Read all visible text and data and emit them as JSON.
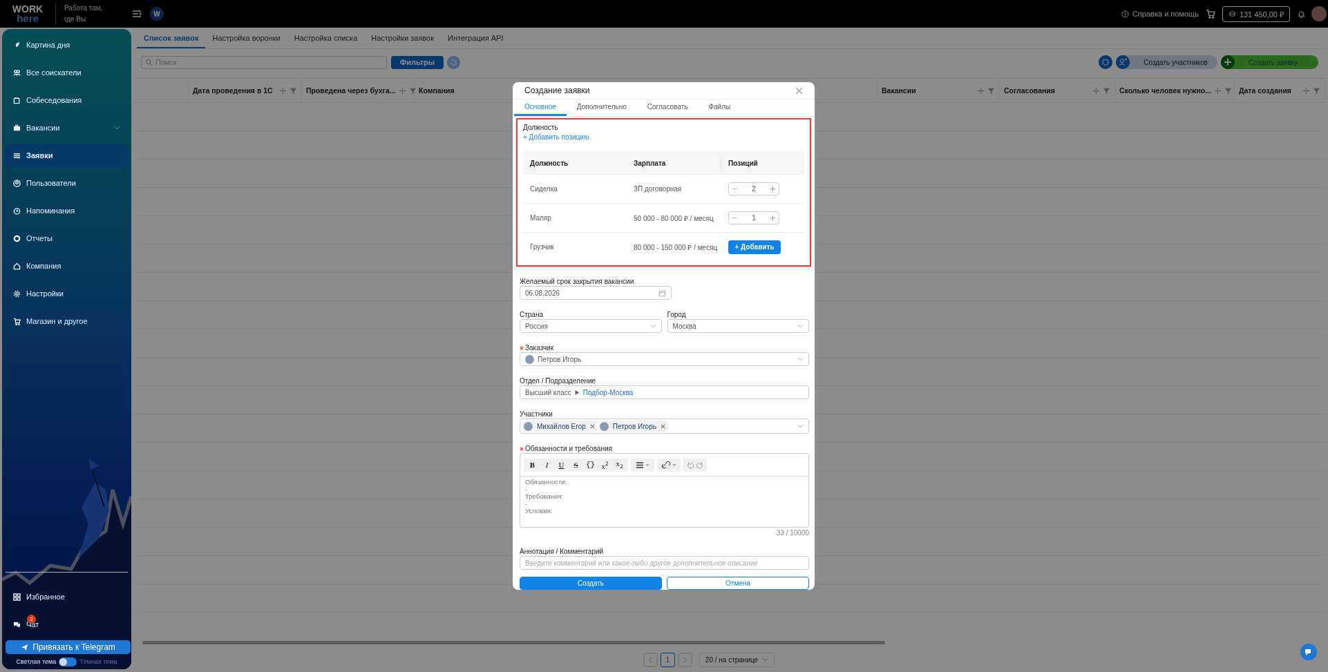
{
  "header": {
    "logo_top": "WORK",
    "logo_bottom": "here",
    "tagline": "Работа там, где Вы",
    "org_badge": "W",
    "help": "Справка и помощь",
    "balance": "131 450,00 ₽"
  },
  "sidebar": {
    "items": [
      {
        "label": "Картина дня",
        "selected": false
      },
      {
        "label": "Все соискатели",
        "selected": false
      },
      {
        "label": "Собеседования",
        "selected": false
      },
      {
        "label": "Вакансии",
        "selected": false,
        "expandable": true
      },
      {
        "label": "Заявки",
        "selected": true
      },
      {
        "label": "Пользователи",
        "selected": false
      },
      {
        "label": "Напоминания",
        "selected": false
      },
      {
        "label": "Отчеты",
        "selected": false
      },
      {
        "label": "Компания",
        "selected": false
      },
      {
        "label": "Настройки",
        "selected": false
      },
      {
        "label": "Магазин и другое",
        "selected": false
      }
    ],
    "bottom_items": [
      {
        "label": "Избранное"
      },
      {
        "label": "Чат",
        "badge": "2"
      }
    ],
    "telegram_button": "Привязать к Telegram",
    "theme": {
      "light_label": "Светлая тема",
      "dark_label": "Тёмная тема",
      "dark": false
    }
  },
  "tabs": [
    {
      "label": "Список заявок",
      "selected": true
    },
    {
      "label": "Настройка воронки",
      "selected": false
    },
    {
      "label": "Настройка списка",
      "selected": false
    },
    {
      "label": "Настройки заявок",
      "selected": false
    },
    {
      "label": "Интеграция API",
      "selected": false
    }
  ],
  "toolbar": {
    "search_placeholder": "Поиск",
    "filter_button": "Фильтры",
    "create_participants": "Создать участников",
    "create_request": "Создать заявку"
  },
  "table": {
    "columns": [
      {
        "kind": "blank"
      },
      {
        "kind": "text",
        "label": "Дата проведения в 1С"
      },
      {
        "kind": "text",
        "label": "Проведена через бухга..."
      },
      {
        "kind": "label_only",
        "label": "Компания"
      },
      {
        "kind": "blank"
      },
      {
        "kind": "text",
        "label": "Вакансии"
      },
      {
        "kind": "text",
        "label": "Согласования"
      },
      {
        "kind": "text",
        "label": "Сколько человек нужно..."
      },
      {
        "kind": "text",
        "label": "Дата создания"
      }
    ]
  },
  "pagination": {
    "pages": [
      {
        "label": "1",
        "selected": true
      }
    ],
    "page_size": "20 / на странице"
  },
  "modal": {
    "title": "Создание заявки",
    "tabs": [
      {
        "label": "Основное",
        "selected": true
      },
      {
        "label": "Дополнительно",
        "selected": false
      },
      {
        "label": "Согласовать",
        "selected": false
      },
      {
        "label": "Файлы",
        "selected": false
      }
    ],
    "positions": {
      "highlighted": true,
      "label": "Должность",
      "add_link": "+ Добавить позицию",
      "columns": [
        "Должность",
        "Зарплата",
        "Позиций"
      ],
      "rows": [
        {
          "kind": "counter",
          "title": "Сиделка",
          "salary": "ЗП договорная",
          "count": "2"
        },
        {
          "kind": "counter",
          "title": "Маляр",
          "salary": "50 000 - 80 000 ₽ / месяц",
          "count": "1"
        },
        {
          "kind": "add",
          "title": "Грузчик",
          "salary": "80 000 - 150 000 ₽ / месяц",
          "button": "+ Добавить"
        }
      ]
    },
    "deadline": {
      "label": "Желаемый срок закрытия вакансии",
      "value": "06.08.2026"
    },
    "country": {
      "label": "Страна",
      "value": "Россия"
    },
    "city": {
      "label": "Город",
      "value": "Москва"
    },
    "customer": {
      "label": "Заказчик",
      "required": true,
      "value": "Петров Игорь"
    },
    "department": {
      "label": "Отдел / Подразделение",
      "path": [
        "Высший класс",
        "Подбор-Москва"
      ]
    },
    "participants": {
      "label": "Участники",
      "people": [
        {
          "name": "Михайлов Егор"
        },
        {
          "name": "Петров Игорь"
        }
      ]
    },
    "duties": {
      "label": "Обязанности и требования",
      "required": true,
      "format_buttons": [
        {
          "kind": "bold",
          "label": "B"
        },
        {
          "kind": "italic",
          "label": "I"
        },
        {
          "kind": "underline",
          "label": "U"
        },
        {
          "kind": "strike",
          "label": "S"
        },
        {
          "kind": "code",
          "label": "{}"
        },
        {
          "kind": "plain",
          "label": "x$^{2}$"
        },
        {
          "kind": "plain",
          "label": "x$_{2}$"
        }
      ],
      "lines": [
        "Обязанности:",
        "-",
        "Требования:",
        "-",
        "Условия:"
      ],
      "counter": "33 / 10000"
    },
    "comment": {
      "label": "Аннотация / Комментарий",
      "placeholder": "Введите комментарий или какое-либо другое дополнительное описание"
    },
    "submit": "Создать",
    "cancel": "Отмена"
  }
}
